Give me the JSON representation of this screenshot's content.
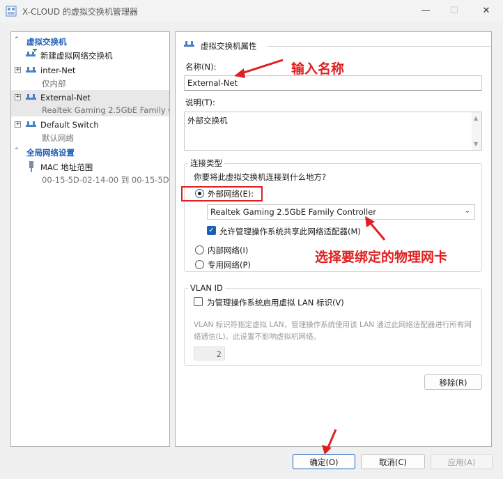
{
  "window": {
    "title": "X-CLOUD 的虚拟交换机管理器"
  },
  "sidebar": {
    "section_switches": "虚拟交换机",
    "new_switch": "新建虚拟网络交换机",
    "switches": [
      {
        "name": "inter-Net",
        "sub": "仅内部"
      },
      {
        "name": "External-Net",
        "sub": "Realtek Gaming 2.5GbE Family C..."
      },
      {
        "name": "Default Switch",
        "sub": "默认网络"
      }
    ],
    "section_global": "全局网络设置",
    "mac": {
      "name": "MAC 地址范围",
      "sub": "00-15-5D-02-14-00 到 00-15-5D-..."
    }
  },
  "properties": {
    "heading": "虚拟交换机属性",
    "name_label": "名称(N):",
    "name_value": "External-Net",
    "notes_label": "说明(T):",
    "notes_value": "外部交换机",
    "conn_type": {
      "title": "连接类型",
      "question": "你要将此虚拟交换机连接到什么地方?",
      "external_label": "外部网络(E):",
      "adapter_selected": "Realtek Gaming 2.5GbE Family Controller",
      "allow_mgmt_label": "允许管理操作系统共享此网络适配器(M)",
      "internal_label": "内部网络(I)",
      "private_label": "专用网络(P)",
      "selected": "external"
    },
    "vlan": {
      "title": "VLAN ID",
      "enable_label": "为管理操作系统启用虚拟 LAN 标识(V)",
      "desc": "VLAN 标识符指定虚拟 LAN，管理操作系统使用该 LAN 通过此网络适配器进行所有网络通信(L)。此设置不影响虚拟机网络。",
      "value": "2"
    },
    "remove_button": "移除(R)"
  },
  "footer": {
    "ok": "确定(O)",
    "cancel": "取消(C)",
    "apply": "应用(A)"
  },
  "annotations": {
    "enter_name": "输入名称",
    "select_nic": "选择要绑定的物理网卡"
  },
  "colors": {
    "accent": "#1a5fb4",
    "annotation_red": "#e02020"
  }
}
